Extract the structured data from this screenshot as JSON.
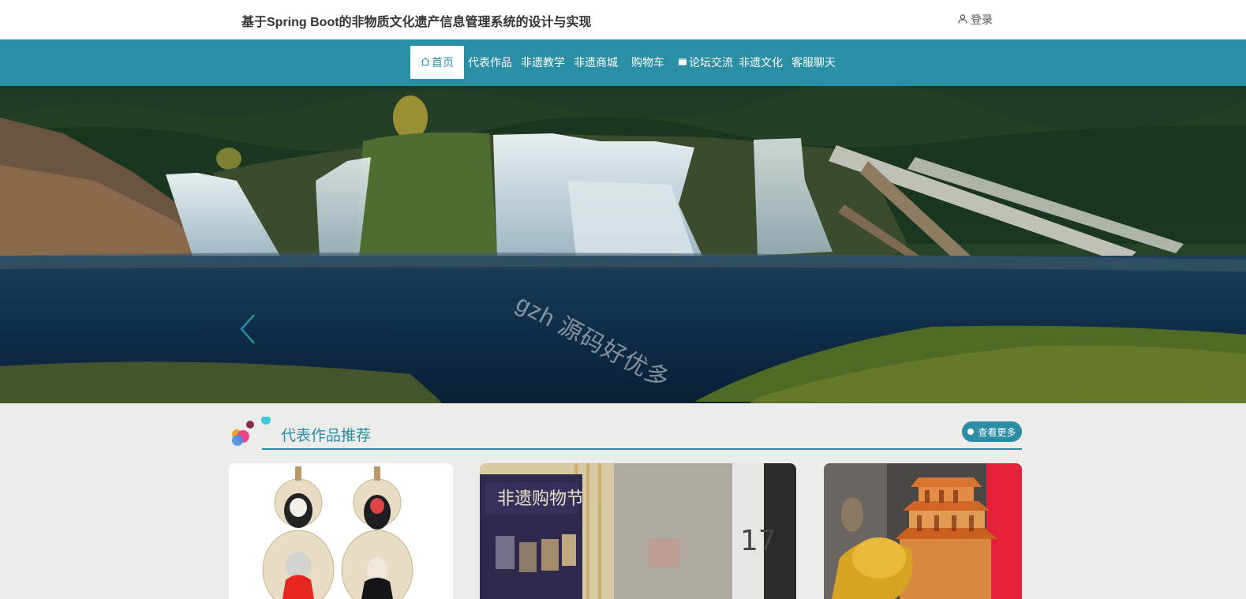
{
  "header": {
    "title": "基于Spring Boot的非物质文化遗产信息管理系统的设计与实现",
    "login_label": "登录"
  },
  "nav": {
    "items": [
      "首页",
      "代表作品",
      "非遗教学",
      "非遗商城",
      "购物车",
      "论坛交流",
      "非遗文化",
      "客服聊天"
    ]
  },
  "banner": {
    "watermark": "gzh 源码好优多"
  },
  "section": {
    "title": "代表作品推荐",
    "more_label": "查看更多"
  },
  "colors": {
    "accent": "#2a8ea5",
    "page_bg": "#ececea"
  }
}
